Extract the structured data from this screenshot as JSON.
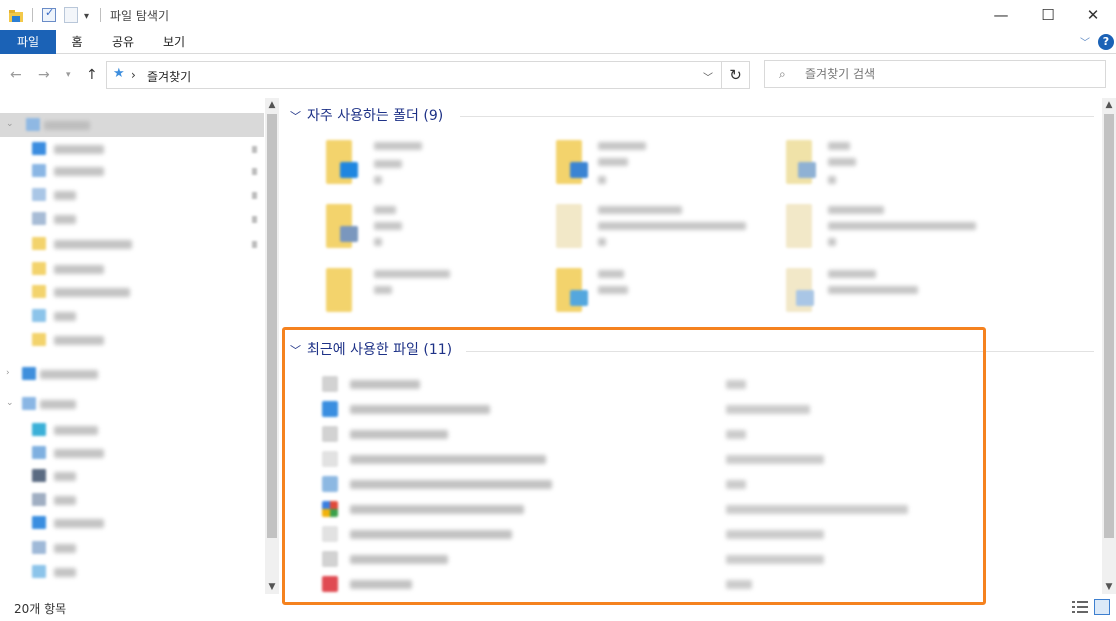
{
  "window": {
    "title": "파일 탐색기",
    "controls": {
      "minimize": "—",
      "maximize": "☐",
      "close": "✕"
    }
  },
  "ribbon": {
    "tabs": [
      {
        "label": "파일"
      },
      {
        "label": "홈"
      },
      {
        "label": "공유"
      },
      {
        "label": "보기"
      }
    ],
    "help": "?"
  },
  "address": {
    "separator": "›",
    "location": "즐겨찾기",
    "search_placeholder": "즐겨찾기 검색"
  },
  "content": {
    "frequent_header": "자주 사용하는 폴더 (9)",
    "recent_header": "최근에 사용한 파일 (11)"
  },
  "status": {
    "item_count": "20개 항목"
  },
  "colors": {
    "accent": "#1b62b6",
    "group_header": "#1e3287",
    "highlight": "#f5821f",
    "folder": "#f3d36c"
  }
}
